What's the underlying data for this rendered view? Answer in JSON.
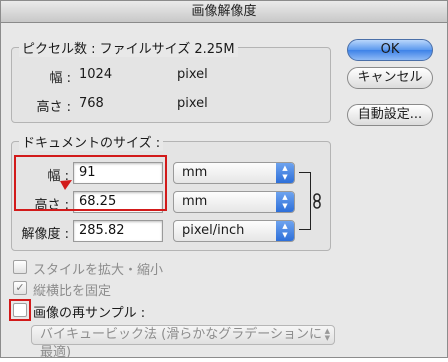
{
  "window": {
    "title": "画像解像度"
  },
  "pixel_dimensions": {
    "title": "ピクセル数 : ファイルサイズ 2.25M",
    "width_label": "幅 :",
    "width_value": "1024",
    "width_unit": "pixel",
    "height_label": "高さ :",
    "height_value": "768",
    "height_unit": "pixel"
  },
  "document_size": {
    "title": "ドキュメントのサイズ :",
    "width_label": "幅 :",
    "width_value": "91",
    "width_unit": "mm",
    "height_label": "高さ :",
    "height_value": "68.25",
    "height_unit": "mm",
    "resolution_label": "解像度 :",
    "resolution_value": "285.82",
    "resolution_unit": "pixel/inch"
  },
  "buttons": {
    "ok": "OK",
    "cancel": "キャンセル",
    "auto": "自動設定..."
  },
  "options": {
    "scale_styles": {
      "label": "スタイルを拡大・縮小",
      "checked": false,
      "enabled": false
    },
    "constrain": {
      "label": "縦横比を固定",
      "checked": true,
      "enabled": false
    },
    "resample": {
      "label": "画像の再サンプル :",
      "checked": false,
      "enabled": true
    },
    "method": "バイキュービック法 (滑らかなグラデーションに最適)"
  },
  "colors": {
    "highlight": "#d21a1a",
    "accent": "#3d82e8"
  }
}
